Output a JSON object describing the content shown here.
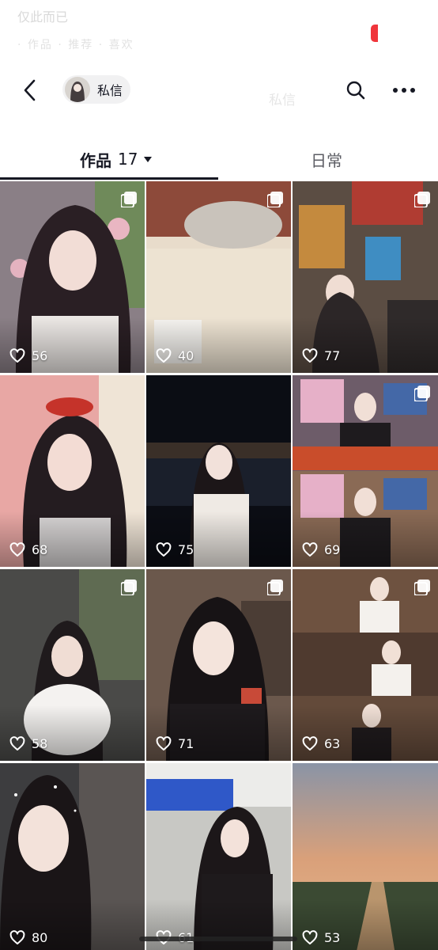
{
  "ghost": {
    "line1": "仅此而已",
    "line2": "· 作品 · 推荐 · 喜欢",
    "mid": "私信"
  },
  "header": {
    "back_icon": "chevron-left-icon",
    "message_chip_label": "私信",
    "search_icon": "search-icon",
    "more_icon": "ellipsis-icon"
  },
  "tabs": {
    "works_label": "作品",
    "works_count": "17",
    "daily_label": "日常"
  },
  "colors": {
    "accent_red": "#f0353b",
    "text": "#161823",
    "muted": "#5b5c63"
  },
  "posts": [
    {
      "likes": "56",
      "multi": true
    },
    {
      "likes": "40",
      "multi": true
    },
    {
      "likes": "77",
      "multi": true
    },
    {
      "likes": "68",
      "multi": false
    },
    {
      "likes": "75",
      "multi": false
    },
    {
      "likes": "69",
      "multi": true
    },
    {
      "likes": "58",
      "multi": true
    },
    {
      "likes": "71",
      "multi": true
    },
    {
      "likes": "63",
      "multi": true
    },
    {
      "likes": "80",
      "multi": false
    },
    {
      "likes": "61",
      "multi": false
    },
    {
      "likes": "53",
      "multi": false
    }
  ]
}
